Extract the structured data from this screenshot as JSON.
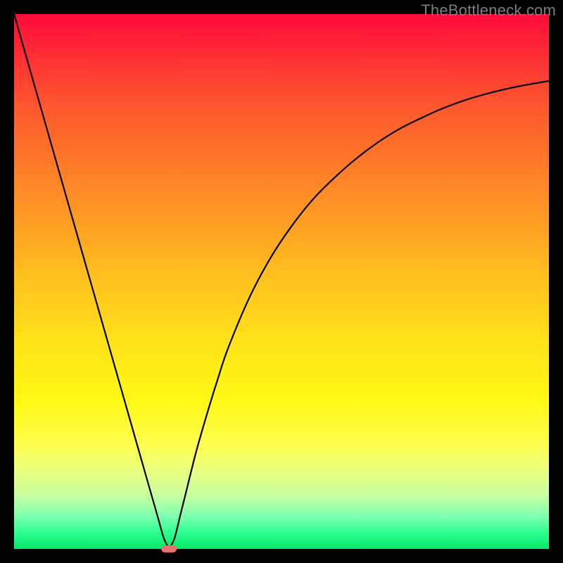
{
  "watermark": "TheBottleneck.com",
  "colors": {
    "frame": "#000000",
    "curve": "#000000",
    "marker": "#e97070",
    "watermark": "#7d7d7d"
  },
  "chart_data": {
    "type": "line",
    "title": "",
    "xlabel": "",
    "ylabel": "",
    "xlim": [
      0,
      100
    ],
    "ylim": [
      0,
      100
    ],
    "x": [
      0,
      2,
      4,
      6,
      8,
      10,
      12,
      14,
      16,
      18,
      20,
      22,
      24,
      26,
      27,
      28,
      29,
      30,
      31,
      32,
      34,
      36,
      38,
      40,
      44,
      48,
      52,
      56,
      60,
      64,
      68,
      72,
      76,
      80,
      84,
      88,
      92,
      96,
      100
    ],
    "values": [
      100,
      93,
      86,
      79,
      72,
      65,
      58,
      51,
      44,
      37,
      30,
      23,
      16,
      9,
      5.5,
      2,
      0,
      2,
      6,
      10,
      18,
      25,
      31.5,
      37.5,
      47,
      54.5,
      60.5,
      65.5,
      69.5,
      73,
      76,
      78.5,
      80.5,
      82.3,
      83.8,
      85,
      86,
      86.8,
      87.5
    ],
    "marker": {
      "x": 29,
      "y": 0
    },
    "description": "V-shaped bottleneck curve with sharp cusp near x≈29% reaching ~0, left branch nearly linear to 100 at x=0, right branch asymptotically rising toward ~88 at x=100"
  }
}
